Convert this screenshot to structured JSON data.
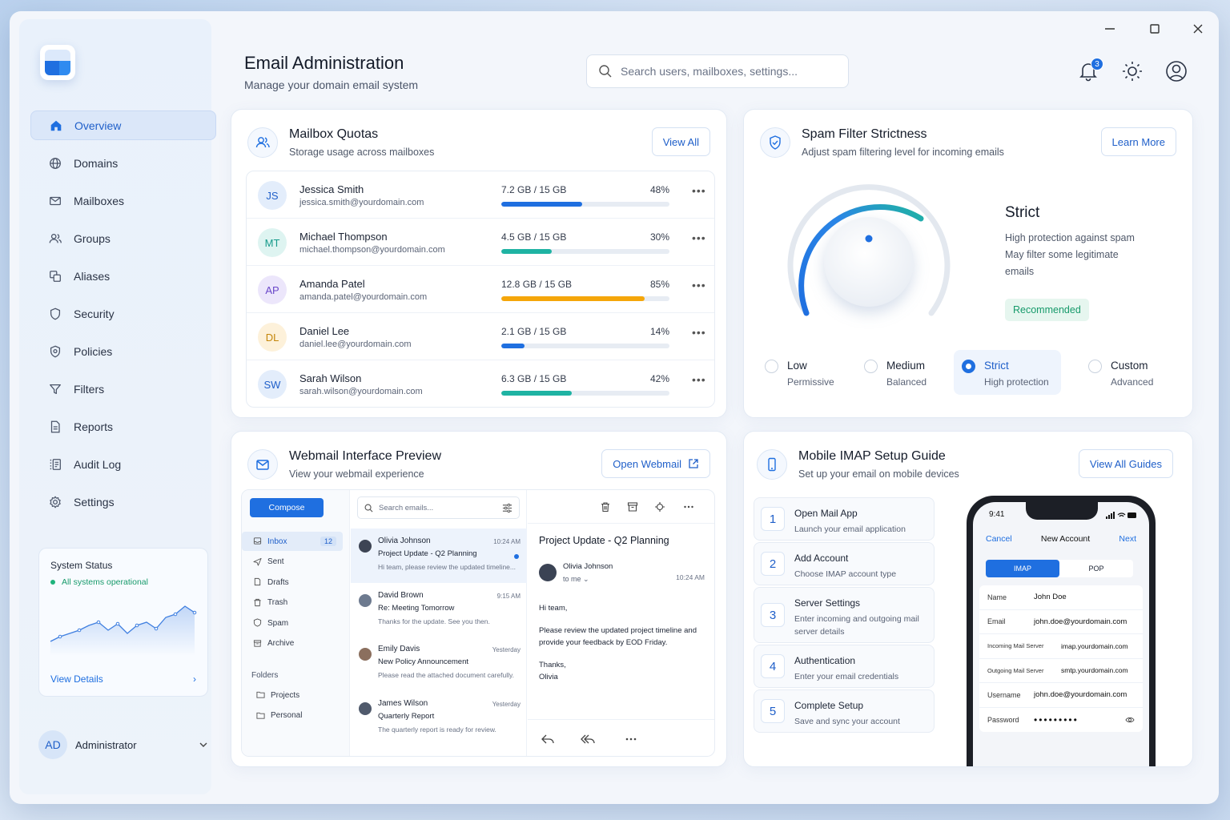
{
  "header": {
    "title": "Email Administration",
    "subtitle": "Manage your domain email system",
    "search_placeholder": "Search users, mailboxes, settings...",
    "notification_count": "3"
  },
  "sidebar": {
    "items": [
      {
        "label": "Overview",
        "icon": "home-icon",
        "active": true
      },
      {
        "label": "Domains",
        "icon": "globe-icon"
      },
      {
        "label": "Mailboxes",
        "icon": "mail-icon"
      },
      {
        "label": "Groups",
        "icon": "users-icon"
      },
      {
        "label": "Aliases",
        "icon": "alias-icon"
      },
      {
        "label": "Security",
        "icon": "shield-icon"
      },
      {
        "label": "Policies",
        "icon": "policy-icon"
      },
      {
        "label": "Filters",
        "icon": "filter-icon"
      },
      {
        "label": "Reports",
        "icon": "report-icon"
      },
      {
        "label": "Audit Log",
        "icon": "log-icon"
      },
      {
        "label": "Settings",
        "icon": "gear-icon"
      }
    ],
    "status": {
      "title": "System Status",
      "state": "All systems operational",
      "link": "View Details"
    },
    "user": {
      "initials": "AD",
      "name": "Administrator"
    }
  },
  "quotas": {
    "title": "Mailbox Quotas",
    "subtitle": "Storage usage across mailboxes",
    "button": "View All",
    "rows": [
      {
        "initials": "JS",
        "name": "Jessica Smith",
        "email": "jessica.smith@yourdomain.com",
        "usage": "7.2 GB / 15 GB",
        "pct": "48%",
        "fill": 48,
        "color": "#1f6fe0",
        "avbg": "#e3edfb",
        "avfg": "#1f5fc9"
      },
      {
        "initials": "MT",
        "name": "Michael Thompson",
        "email": "michael.thompson@yourdomain.com",
        "usage": "4.5 GB / 15 GB",
        "pct": "30%",
        "fill": 30,
        "color": "#1fb3a3",
        "avbg": "#def4f1",
        "avfg": "#159a8a"
      },
      {
        "initials": "AP",
        "name": "Amanda Patel",
        "email": "amanda.patel@yourdomain.com",
        "usage": "12.8 GB / 15 GB",
        "pct": "85%",
        "fill": 85,
        "color": "#f5a60a",
        "avbg": "#ece6fb",
        "avfg": "#6a47c9"
      },
      {
        "initials": "DL",
        "name": "Daniel Lee",
        "email": "daniel.lee@yourdomain.com",
        "usage": "2.1 GB / 15 GB",
        "pct": "14%",
        "fill": 14,
        "color": "#1f6fe0",
        "avbg": "#fdf1da",
        "avfg": "#c4860a"
      },
      {
        "initials": "SW",
        "name": "Sarah Wilson",
        "email": "sarah.wilson@yourdomain.com",
        "usage": "6.3 GB / 15 GB",
        "pct": "42%",
        "fill": 42,
        "color": "#1fb3a3",
        "avbg": "#e3edfb",
        "avfg": "#1f5fc9"
      }
    ]
  },
  "spam": {
    "title": "Spam Filter Strictness",
    "subtitle": "Adjust spam filtering level for incoming emails",
    "button": "Learn More",
    "level": "Strict",
    "desc": [
      "High protection against spam",
      "May filter some legitimate",
      "emails"
    ],
    "tag": "Recommended",
    "options": [
      {
        "label": "Low",
        "desc": "Permissive",
        "selected": false
      },
      {
        "label": "Medium",
        "desc": "Balanced",
        "selected": false
      },
      {
        "label": "Strict",
        "desc": "High protection",
        "selected": true
      },
      {
        "label": "Custom",
        "desc": "Advanced",
        "selected": false
      }
    ]
  },
  "webmail": {
    "title": "Webmail Interface Preview",
    "subtitle": "View your webmail experience",
    "button": "Open Webmail",
    "compose": "Compose",
    "folders": [
      {
        "label": "Inbox",
        "count": "12"
      },
      {
        "label": "Sent"
      },
      {
        "label": "Drafts"
      },
      {
        "label": "Trash"
      },
      {
        "label": "Spam"
      },
      {
        "label": "Archive"
      }
    ],
    "folders_heading": "Folders",
    "custom_folders": [
      "Projects",
      "Personal"
    ],
    "search_placeholder": "Search emails...",
    "messages": [
      {
        "from": "Olivia Johnson",
        "time": "10:24 AM",
        "subject": "Project Update - Q2 Planning",
        "preview": "Hi team, please review the updated timeline...",
        "unread": true
      },
      {
        "from": "David Brown",
        "time": "9:15 AM",
        "subject": "Re: Meeting Tomorrow",
        "preview": "Thanks for the update. See you then."
      },
      {
        "from": "Emily Davis",
        "time": "Yesterday",
        "subject": "New Policy Announcement",
        "preview": "Please read the attached document carefully."
      },
      {
        "from": "James Wilson",
        "time": "Yesterday",
        "subject": "Quarterly Report",
        "preview": "The quarterly report is ready for review."
      }
    ],
    "reading": {
      "subject": "Project Update - Q2 Planning",
      "from": "Olivia Johnson",
      "to": "to me",
      "time": "10:24 AM",
      "greeting": "Hi team,",
      "body": "Please review the updated project timeline and provide your feedback by EOD Friday.",
      "closing": "Thanks,",
      "signature": "Olivia"
    }
  },
  "imap": {
    "title": "Mobile IMAP Setup Guide",
    "subtitle": "Set up your email on mobile devices",
    "button": "View All Guides",
    "steps": [
      {
        "n": "1",
        "title": "Open Mail App",
        "desc": "Launch your email application"
      },
      {
        "n": "2",
        "title": "Add Account",
        "desc": "Choose IMAP account type"
      },
      {
        "n": "3",
        "title": "Server Settings",
        "desc": "Enter incoming and outgoing mail server details"
      },
      {
        "n": "4",
        "title": "Authentication",
        "desc": "Enter your email credentials"
      },
      {
        "n": "5",
        "title": "Complete Setup",
        "desc": "Save and sync your account"
      }
    ],
    "phone": {
      "time": "9:41",
      "cancel": "Cancel",
      "title": "New Account",
      "next": "Next",
      "tab_on": "IMAP",
      "tab_off": "POP",
      "fields": [
        {
          "k": "Name",
          "v": "John Doe"
        },
        {
          "k": "Email",
          "v": "john.doe@yourdomain.com"
        },
        {
          "k": "Incoming Mail Server",
          "v": "imap.yourdomain.com"
        },
        {
          "k": "Outgoing Mail Server",
          "v": "smtp.yourdomain.com"
        },
        {
          "k": "Username",
          "v": "john.doe@yourdomain.com"
        },
        {
          "k": "Password",
          "v": "•••••••••"
        }
      ]
    }
  }
}
